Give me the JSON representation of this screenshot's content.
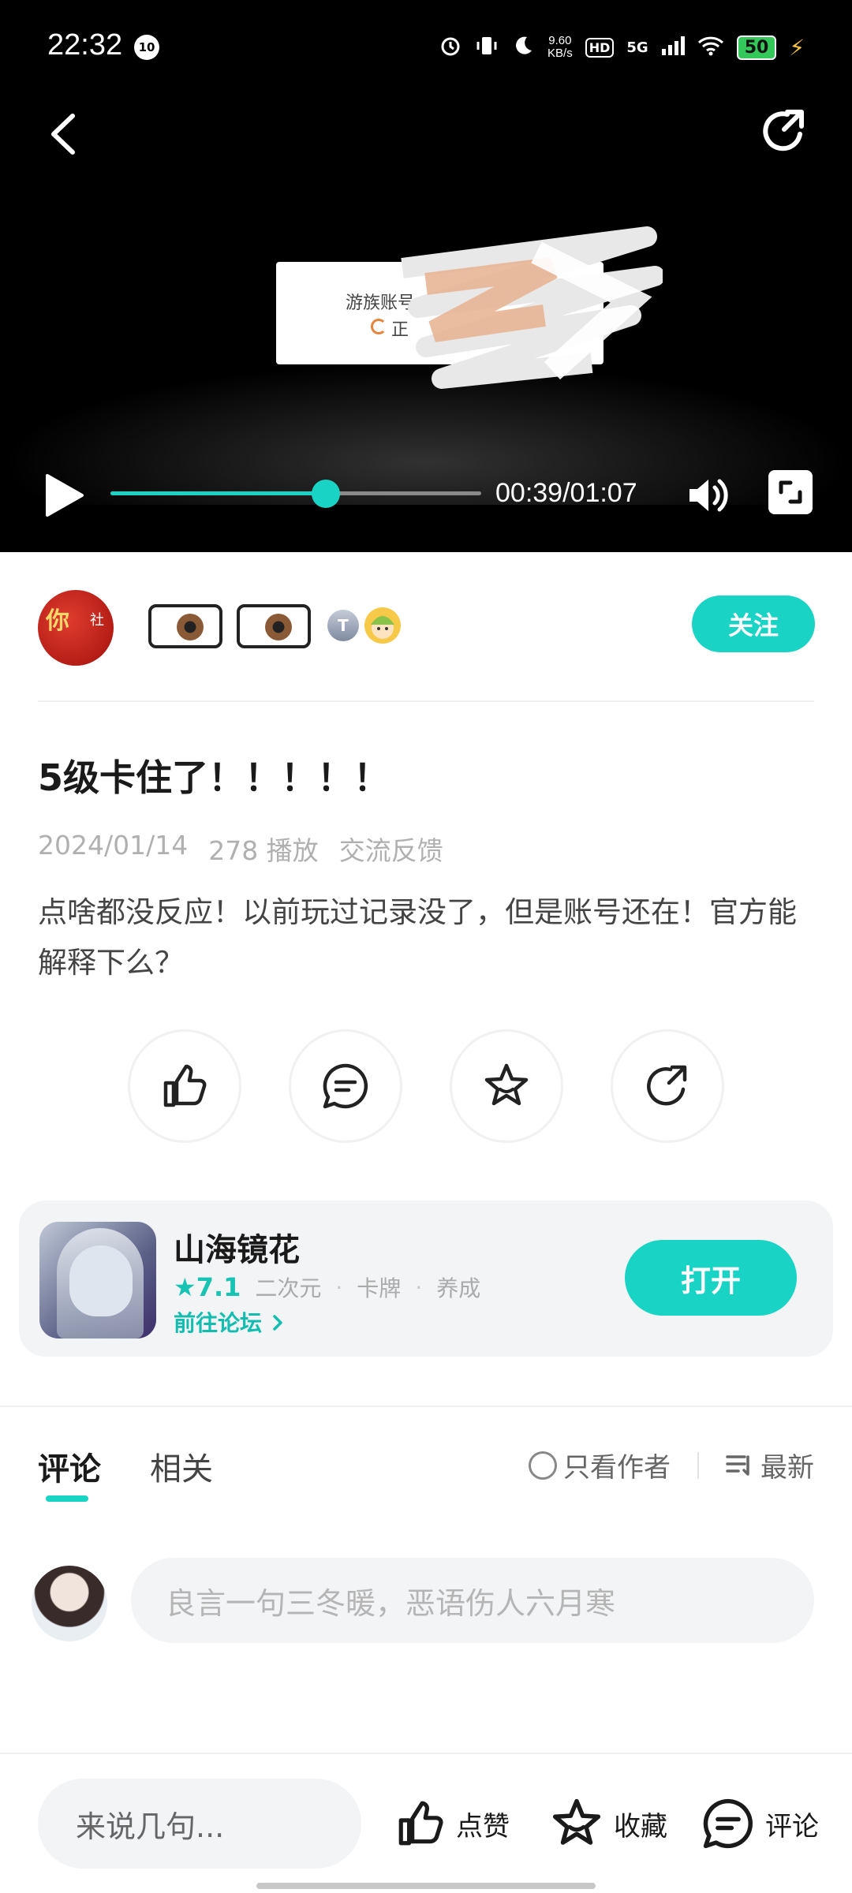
{
  "status_bar": {
    "time": "22:32",
    "badge": "10",
    "speed_value": "9.60",
    "speed_unit": "KB/s",
    "hd": "HD",
    "network": "5G",
    "battery": "50"
  },
  "video": {
    "frame_text_1": "游族账号",
    "frame_text_2": "正",
    "current_time": "00:39",
    "duration": "01:07",
    "time_label": "00:39/01:07",
    "progress": 0.58,
    "accent_color": "#19d3c5"
  },
  "author": {
    "follow_label": "关注",
    "avatar_text": "你",
    "avatar_text_2": "社",
    "badge_letter": "T"
  },
  "post": {
    "title": "5级卡住了！！！！！",
    "date": "2024/01/14",
    "plays": "278 播放",
    "category": "交流反馈",
    "body": "点啥都没反应！以前玩过记录没了，但是账号还在！官方能解释下么？"
  },
  "actions": {
    "icons": [
      "thumbs-up-icon",
      "comment-icon",
      "star-icon",
      "share-icon"
    ]
  },
  "game_card": {
    "name": "山海镜花",
    "rating": "★7.1",
    "tags": [
      "二次元",
      "卡牌",
      "养成"
    ],
    "forum_link": "前往论坛",
    "open_label": "打开"
  },
  "comments": {
    "tabs": [
      {
        "label": "评论",
        "active": true
      },
      {
        "label": "相关",
        "active": false
      }
    ],
    "only_author": "只看作者",
    "sort": "最新",
    "input_placeholder": "良言一句三冬暖，恶语伤人六月寒"
  },
  "bottom_bar": {
    "input_placeholder": "来说几句...",
    "like": "点赞",
    "favorite": "收藏",
    "comment": "评论"
  }
}
